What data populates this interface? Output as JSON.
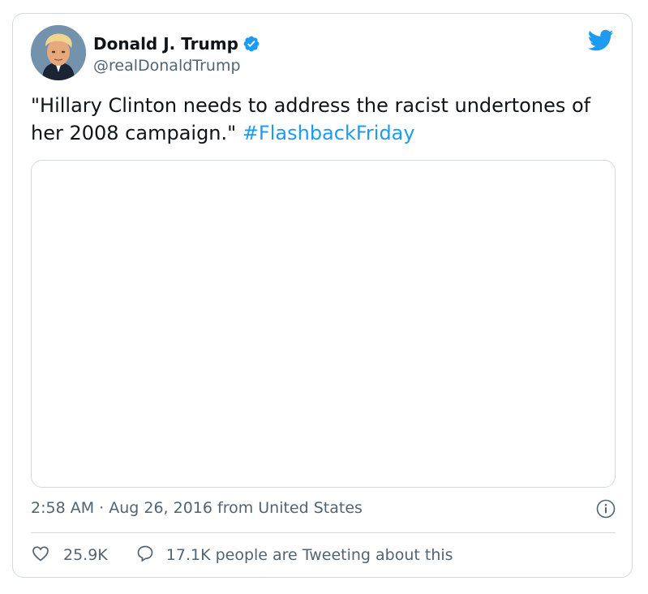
{
  "tweet": {
    "author_name": "Donald J. Trump",
    "handle": "@realDonaldTrump",
    "text": "\"Hillary Clinton needs to address the racist undertones of her 2008 campaign.\" ",
    "hashtag": "#FlashbackFriday",
    "meta": "2:58 AM · Aug 26, 2016 from United States",
    "likes": "25.9K",
    "conversation": "17.1K people are Tweeting about this"
  },
  "colors": {
    "accent": "#1d9bf0",
    "text": "#0f1419",
    "secondary_text": "#536471",
    "border": "#cfd9de"
  },
  "icons": {
    "verified": "verified-badge-icon",
    "brand": "twitter-bird-icon",
    "info": "info-icon",
    "like": "heart-icon",
    "reply": "speech-bubble-icon"
  }
}
